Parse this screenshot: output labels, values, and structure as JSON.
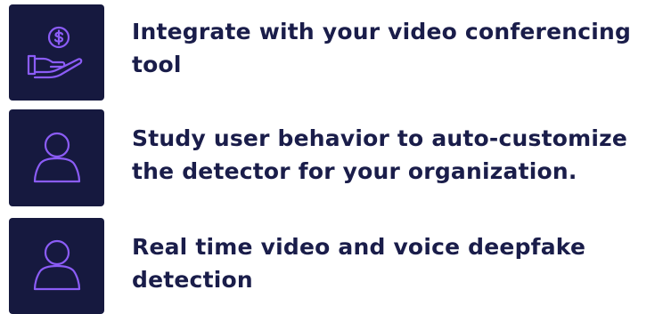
{
  "colors": {
    "tile_background": "#16193f",
    "icon_stroke": "#8b5cf6",
    "text": "#1a1d4a"
  },
  "features": [
    {
      "icon": "money-hand-icon",
      "text": "Integrate with your video conferencing tool"
    },
    {
      "icon": "user-icon",
      "text": "Study user behavior to auto-customize the detector for your organization."
    },
    {
      "icon": "user-icon",
      "text": "Real time video and voice deepfake detection"
    }
  ]
}
